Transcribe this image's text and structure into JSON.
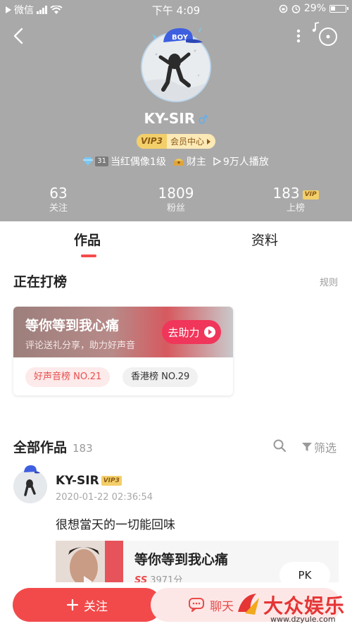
{
  "status_bar": {
    "carrier": "微信",
    "time": "下午 4:09",
    "battery": "29%"
  },
  "profile": {
    "cap_text": "BOY",
    "username": "KY-SIR",
    "gender_icon": "male-icon",
    "vip_level": "VIP3",
    "vip_center": "会员中心",
    "idol_level_num": "31",
    "idol_level": "当红偶像1级",
    "wealth": "财主",
    "plays": "9万人播放"
  },
  "stats": [
    {
      "value": "63",
      "label": "关注"
    },
    {
      "value": "1809",
      "label": "粉丝"
    },
    {
      "value": "183",
      "label": "上榜",
      "tag": "VIP"
    }
  ],
  "tabs": [
    {
      "label": "作品",
      "active": true
    },
    {
      "label": "资料",
      "active": false
    }
  ],
  "charting": {
    "section_title": "正在打榜",
    "rules": "规则",
    "song_title": "等你等到我心痛",
    "subtitle": "评论送礼分享，助力好声音",
    "help_button": "去助力",
    "ranks": [
      "好声音榜 NO.21",
      "香港榜 NO.29"
    ]
  },
  "works": {
    "title": "全部作品",
    "count": "183",
    "filter": "筛选"
  },
  "post": {
    "username": "KY-SIR",
    "vip": "VIP3",
    "time": "2020-01-22 02:36:54",
    "text": "很想當天的一切能回味",
    "song_title": "等你等到我心痛",
    "grade": "SS",
    "score": "3971分",
    "pk": "PK"
  },
  "bottom": {
    "follow": "关注",
    "chat": "聊天"
  },
  "watermark": {
    "brand": "大众娱乐",
    "url": "www.dzyule.com"
  },
  "colors": {
    "header_bg": "#a9a9a9",
    "accent_red": "#f24a4a",
    "help_btn": "#f0365a",
    "vip_gold": "#f3cf6a"
  }
}
